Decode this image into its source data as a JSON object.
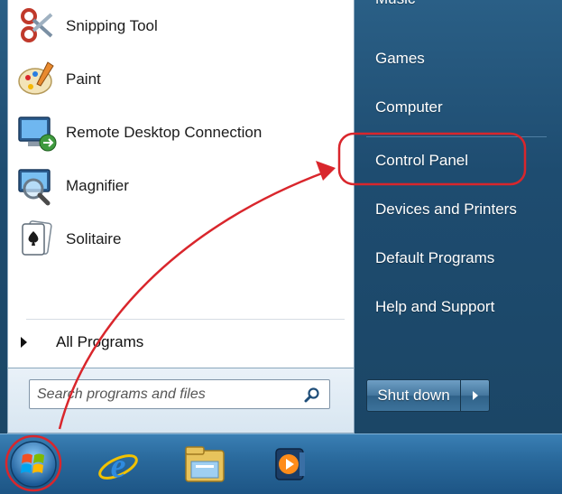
{
  "programs": [
    {
      "label": "Snipping Tool",
      "icon": "snipping-tool-icon"
    },
    {
      "label": "Paint",
      "icon": "paint-icon"
    },
    {
      "label": "Remote Desktop Connection",
      "icon": "remote-desktop-icon"
    },
    {
      "label": "Magnifier",
      "icon": "magnifier-icon"
    },
    {
      "label": "Solitaire",
      "icon": "solitaire-icon"
    }
  ],
  "all_programs_label": "All Programs",
  "search": {
    "placeholder": "Search programs and files"
  },
  "right_items": [
    "Music",
    "Games",
    "Computer",
    "Control Panel",
    "Devices and Printers",
    "Default Programs",
    "Help and Support"
  ],
  "shutdown_label": "Shut down",
  "taskbar_icons": [
    "start-orb-icon",
    "internet-explorer-icon",
    "windows-explorer-icon",
    "media-player-icon"
  ],
  "colors": {
    "annotation_red": "#d9262c",
    "menu_blue": "#1e4c70",
    "taskbar_blue": "#2a6a9d"
  }
}
